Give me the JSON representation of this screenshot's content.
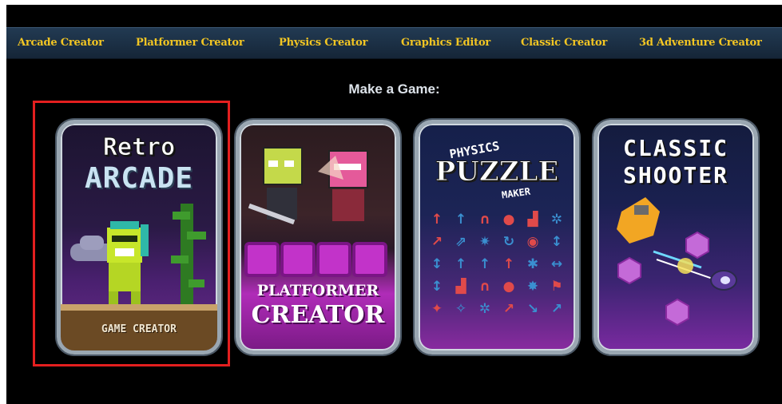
{
  "nav": {
    "items": [
      "Arcade Creator",
      "Platformer Creator",
      "Physics Creator",
      "Graphics Editor",
      "Classic Creator",
      "3d Adventure Creator"
    ]
  },
  "heading": "Make a Game:",
  "cards": [
    {
      "id": "retro-arcade",
      "title_top": "Retro",
      "title_bottom": "ARCADE",
      "footer": "GAME CREATOR",
      "selected": true
    },
    {
      "id": "platformer",
      "title_top": "PLATFORMER",
      "title_bottom": "CREATOR"
    },
    {
      "id": "physics-puzzle",
      "title_top": "PHYSICS",
      "title_mid": "PUZZLE",
      "title_bottom": "MAKER"
    },
    {
      "id": "classic-shooter",
      "title_top": "CLASSIC",
      "title_bottom": "SHOOTER"
    }
  ],
  "colors": {
    "nav_text": "#f3c623",
    "nav_bg": "#1b2f44",
    "selection_outline": "#e31f1f",
    "platformer_magenta": "#c233c9",
    "physics_icon": "#e04a4a",
    "physics_icon_alt": "#3a8fd0"
  },
  "icons": {
    "physics_grid": [
      "up-arrow",
      "down-arrow",
      "magnet",
      "motor",
      "factory",
      "fan",
      "arrows",
      "gear",
      "bomb",
      "spring",
      "rotate",
      "swap",
      "flag",
      "star"
    ]
  }
}
